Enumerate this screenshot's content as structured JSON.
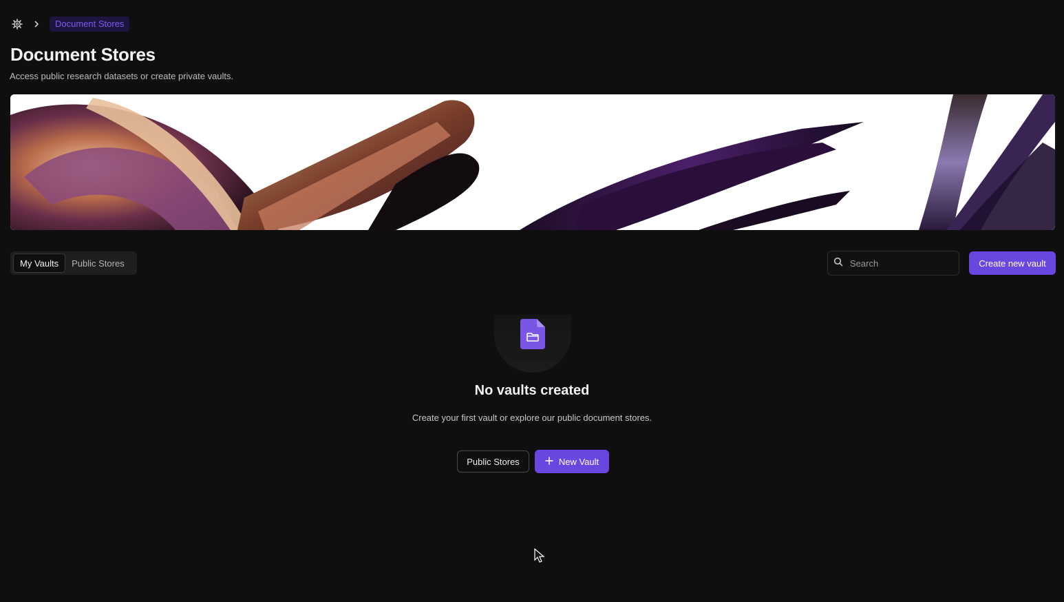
{
  "breadcrumb": {
    "home_icon": "settings-gear-icon",
    "separator_icon": "chevron-right-icon",
    "current": "Document Stores"
  },
  "header": {
    "title": "Document Stores",
    "subtitle": "Access public research datasets or create private vaults."
  },
  "tabs": [
    {
      "label": "My Vaults",
      "active": true
    },
    {
      "label": "Public Stores",
      "active": false
    }
  ],
  "search": {
    "placeholder": "Search",
    "value": ""
  },
  "actions": {
    "create_label": "Create new vault"
  },
  "empty_state": {
    "icon": "document-folder-icon",
    "title": "No vaults created",
    "description": "Create your first vault or explore our public document stores.",
    "secondary_label": "Public Stores",
    "primary_label": "New Vault",
    "primary_icon": "plus-icon"
  },
  "colors": {
    "background": "#0f0f0f",
    "accent": "#6a46e0",
    "breadcrumb_active_bg": "#1e1440",
    "breadcrumb_active_text": "#7b5cf0"
  }
}
